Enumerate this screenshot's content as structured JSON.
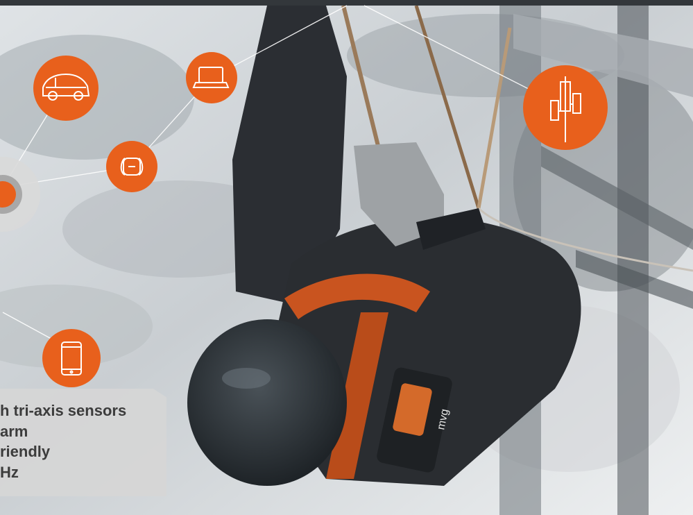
{
  "colors": {
    "accent_orange": "#e8601c",
    "header_bar": "#33373b",
    "hub_ring": "#d9d9d9",
    "connector_line": "#ffffff",
    "feature_text": "#3c3c3c"
  },
  "device_label": "mvg",
  "connected_devices": [
    {
      "name": "car-icon"
    },
    {
      "name": "laptop-icon"
    },
    {
      "name": "smartwatch-icon"
    },
    {
      "name": "smartphone-icon"
    },
    {
      "name": "cell-tower-icon"
    }
  ],
  "features": [
    "h tri-axis sensors",
    "arm",
    "riendly",
    "Hz"
  ]
}
